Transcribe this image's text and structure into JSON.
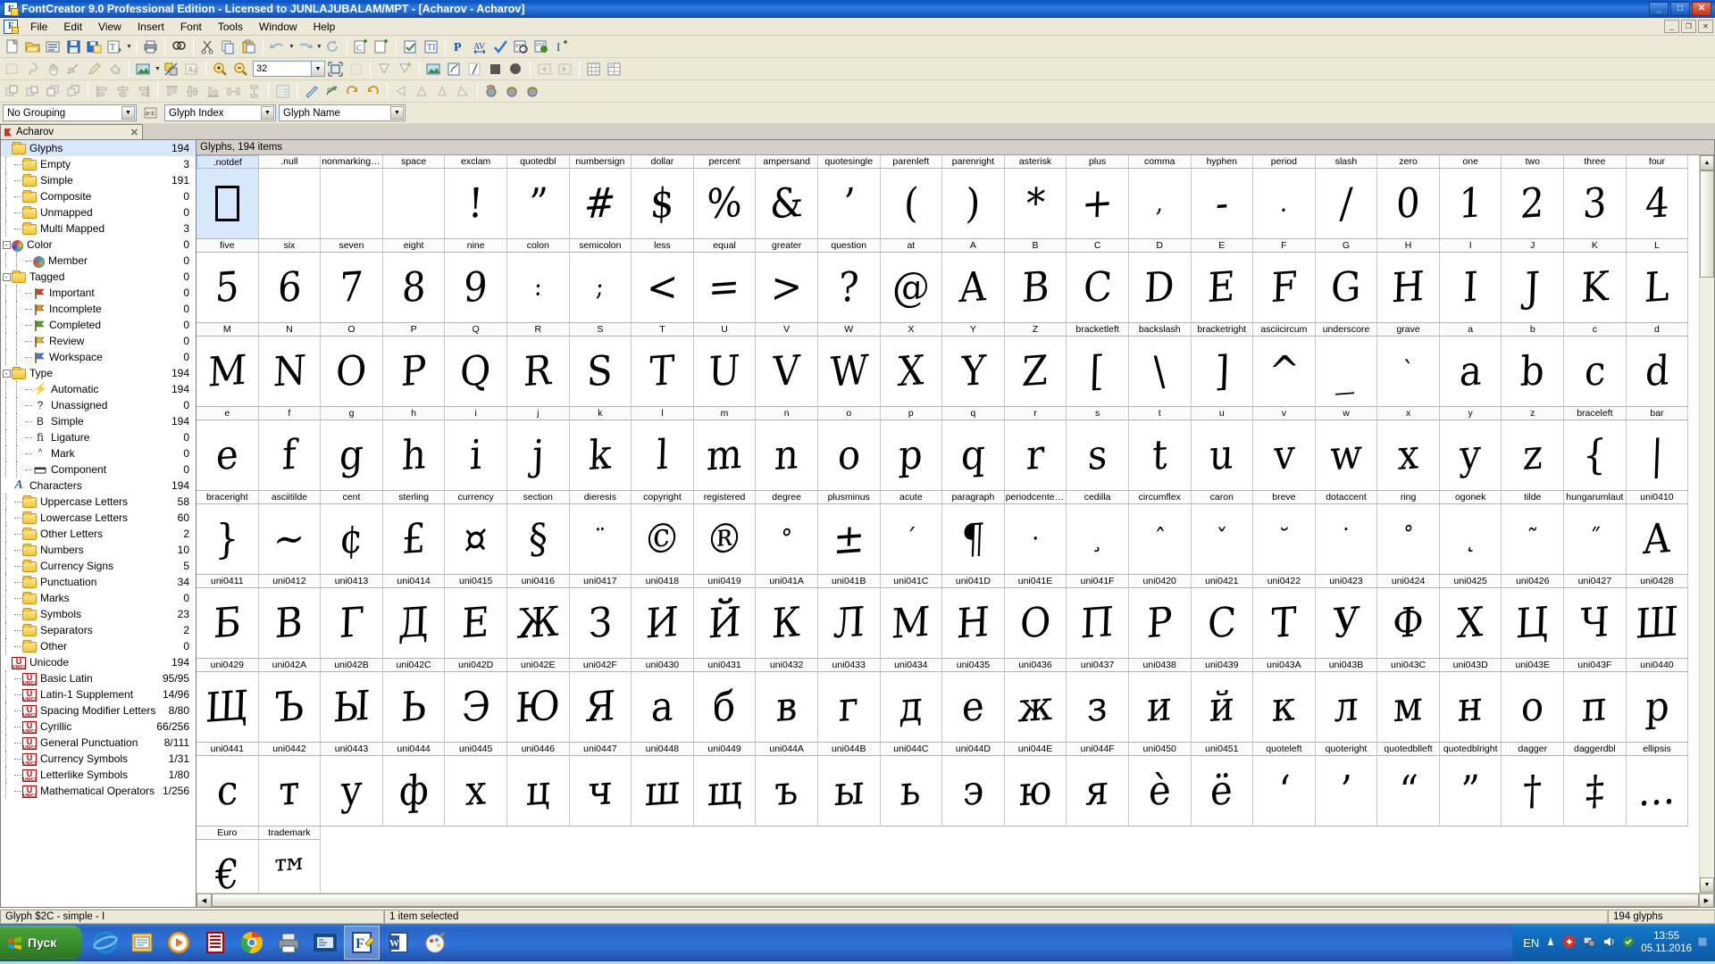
{
  "window": {
    "title": "FontCreator 9.0 Professional Edition - Licensed to JUNLAJUBALAM/MPT - [Acharov - Acharov]",
    "app_icon": "F",
    "minimize": "_",
    "maximize": "□",
    "close": "✕",
    "mdi_minimize": "_",
    "mdi_restore": "❐",
    "mdi_close": "✕"
  },
  "menu": {
    "items": [
      "File",
      "Edit",
      "View",
      "Insert",
      "Font",
      "Tools",
      "Window",
      "Help"
    ]
  },
  "toolbars": {
    "zoom_value": "32",
    "grouping": {
      "group_by": "No Grouping",
      "sort_by": "Glyph Index",
      "display": "Glyph Name"
    }
  },
  "doctab": {
    "label": "Acharov",
    "close": "✕"
  },
  "tree": {
    "items": [
      {
        "label": "Glyphs",
        "count": "194",
        "depth": 0,
        "icon": "folder",
        "selected": true,
        "expander": ""
      },
      {
        "label": "Empty",
        "count": "3",
        "depth": 1,
        "icon": "folder",
        "expander": ""
      },
      {
        "label": "Simple",
        "count": "191",
        "depth": 1,
        "icon": "folder",
        "expander": ""
      },
      {
        "label": "Composite",
        "count": "0",
        "depth": 1,
        "icon": "folder",
        "expander": ""
      },
      {
        "label": "Unmapped",
        "count": "0",
        "depth": 1,
        "icon": "folder",
        "expander": ""
      },
      {
        "label": "Multi Mapped",
        "count": "3",
        "depth": 1,
        "icon": "folder",
        "expander": ""
      },
      {
        "label": "Color",
        "count": "0",
        "depth": 0,
        "icon": "color",
        "expander": "-"
      },
      {
        "label": "Member",
        "count": "0",
        "depth": 2,
        "icon": "member",
        "expander": ""
      },
      {
        "label": "Tagged",
        "count": "0",
        "depth": 0,
        "icon": "folder",
        "expander": "-"
      },
      {
        "label": "Important",
        "count": "0",
        "depth": 2,
        "icon": "flag-red",
        "expander": ""
      },
      {
        "label": "Incomplete",
        "count": "0",
        "depth": 2,
        "icon": "flag-orange",
        "expander": ""
      },
      {
        "label": "Completed",
        "count": "0",
        "depth": 2,
        "icon": "flag-green",
        "expander": ""
      },
      {
        "label": "Review",
        "count": "0",
        "depth": 2,
        "icon": "flag-yellow",
        "expander": ""
      },
      {
        "label": "Workspace",
        "count": "0",
        "depth": 2,
        "icon": "flag-blue",
        "expander": ""
      },
      {
        "label": "Type",
        "count": "194",
        "depth": 0,
        "icon": "folder",
        "expander": "-"
      },
      {
        "label": "Automatic",
        "count": "194",
        "depth": 2,
        "icon": "bolt",
        "expander": ""
      },
      {
        "label": "Unassigned",
        "count": "0",
        "depth": 2,
        "icon": "question",
        "expander": ""
      },
      {
        "label": "Simple",
        "count": "194",
        "depth": 2,
        "icon": "letter-B",
        "expander": ""
      },
      {
        "label": "Ligature",
        "count": "0",
        "depth": 2,
        "icon": "ligature-fi",
        "expander": ""
      },
      {
        "label": "Mark",
        "count": "0",
        "depth": 2,
        "icon": "caret-mark",
        "expander": ""
      },
      {
        "label": "Component",
        "count": "0",
        "depth": 2,
        "icon": "component",
        "expander": ""
      },
      {
        "label": "Characters",
        "count": "194",
        "depth": 0,
        "icon": "letter-A",
        "expander": ""
      },
      {
        "label": "Uppercase Letters",
        "count": "58",
        "depth": 1,
        "icon": "folder",
        "expander": ""
      },
      {
        "label": "Lowercase Letters",
        "count": "60",
        "depth": 1,
        "icon": "folder",
        "expander": ""
      },
      {
        "label": "Other Letters",
        "count": "2",
        "depth": 1,
        "icon": "folder",
        "expander": ""
      },
      {
        "label": "Numbers",
        "count": "10",
        "depth": 1,
        "icon": "folder",
        "expander": ""
      },
      {
        "label": "Currency Signs",
        "count": "5",
        "depth": 1,
        "icon": "folder",
        "expander": ""
      },
      {
        "label": "Punctuation",
        "count": "34",
        "depth": 1,
        "icon": "folder",
        "expander": ""
      },
      {
        "label": "Marks",
        "count": "0",
        "depth": 1,
        "icon": "folder",
        "expander": ""
      },
      {
        "label": "Symbols",
        "count": "23",
        "depth": 1,
        "icon": "folder",
        "expander": ""
      },
      {
        "label": "Separators",
        "count": "2",
        "depth": 1,
        "icon": "folder",
        "expander": ""
      },
      {
        "label": "Other",
        "count": "0",
        "depth": 1,
        "icon": "folder",
        "expander": ""
      },
      {
        "label": "Unicode",
        "count": "194",
        "depth": 0,
        "icon": "unicode",
        "expander": ""
      },
      {
        "label": "Basic Latin",
        "count": "95/95",
        "depth": 1,
        "icon": "unicode",
        "expander": ""
      },
      {
        "label": "Latin-1 Supplement",
        "count": "14/96",
        "depth": 1,
        "icon": "unicode",
        "expander": ""
      },
      {
        "label": "Spacing Modifier Letters",
        "count": "8/80",
        "depth": 1,
        "icon": "unicode",
        "expander": ""
      },
      {
        "label": "Cyrillic",
        "count": "66/256",
        "depth": 1,
        "icon": "unicode",
        "expander": ""
      },
      {
        "label": "General Punctuation",
        "count": "8/111",
        "depth": 1,
        "icon": "unicode",
        "expander": ""
      },
      {
        "label": "Currency Symbols",
        "count": "1/31",
        "depth": 1,
        "icon": "unicode",
        "expander": ""
      },
      {
        "label": "Letterlike Symbols",
        "count": "1/80",
        "depth": 1,
        "icon": "unicode",
        "expander": ""
      },
      {
        "label": "Mathematical Operators",
        "count": "1/256",
        "depth": 1,
        "icon": "unicode",
        "expander": ""
      }
    ]
  },
  "glyphgrid": {
    "header": "Glyphs, 194 items",
    "columns": 22,
    "rows": [
      {
        "labels": [
          ".notdef",
          ".null",
          "nonmarkingre...",
          "space",
          "exclam",
          "quotedbl",
          "numbersign",
          "dollar",
          "percent",
          "ampersand",
          "quotesingle",
          "parenleft",
          "parenright",
          "asterisk",
          "plus",
          "comma",
          "hyphen",
          "period",
          "slash",
          "zero",
          "one",
          "two",
          "three",
          "four"
        ],
        "glyphs": [
          "□",
          "",
          "",
          "",
          "!",
          "”",
          "#",
          "$",
          "%",
          "&",
          "’",
          "(",
          ")",
          "*",
          "+",
          ",",
          "-",
          ".",
          "/",
          "0",
          "1",
          "2",
          "3",
          "4"
        ]
      },
      {
        "labels": [
          "five",
          "six",
          "seven",
          "eight",
          "nine",
          "colon",
          "semicolon",
          "less",
          "equal",
          "greater",
          "question",
          "at",
          "A",
          "B",
          "C",
          "D",
          "E",
          "F",
          "G",
          "H",
          "I",
          "J",
          "K",
          "L"
        ],
        "glyphs": [
          "5",
          "6",
          "7",
          "8",
          "9",
          ":",
          ";",
          "<",
          "=",
          ">",
          "?",
          "@",
          "A",
          "B",
          "C",
          "D",
          "E",
          "F",
          "G",
          "H",
          "I",
          "J",
          "K",
          "L"
        ]
      },
      {
        "labels": [
          "M",
          "N",
          "O",
          "P",
          "Q",
          "R",
          "S",
          "T",
          "U",
          "V",
          "W",
          "X",
          "Y",
          "Z",
          "bracketleft",
          "backslash",
          "bracketright",
          "asciicircum",
          "underscore",
          "grave",
          "a",
          "b",
          "c",
          "d"
        ],
        "glyphs": [
          "M",
          "N",
          "O",
          "P",
          "Q",
          "R",
          "S",
          "T",
          "U",
          "V",
          "W",
          "X",
          "Y",
          "Z",
          "[",
          "\\",
          "]",
          "^",
          "_",
          "`",
          "a",
          "b",
          "c",
          "d"
        ]
      },
      {
        "labels": [
          "e",
          "f",
          "g",
          "h",
          "i",
          "j",
          "k",
          "l",
          "m",
          "n",
          "o",
          "p",
          "q",
          "r",
          "s",
          "t",
          "u",
          "v",
          "w",
          "x",
          "y",
          "z",
          "braceleft",
          "bar"
        ],
        "glyphs": [
          "e",
          "f",
          "g",
          "h",
          "i",
          "j",
          "k",
          "l",
          "m",
          "n",
          "o",
          "p",
          "q",
          "r",
          "s",
          "t",
          "u",
          "v",
          "w",
          "x",
          "y",
          "z",
          "{",
          "|"
        ]
      },
      {
        "labels": [
          "braceright",
          "asciitilde",
          "cent",
          "sterling",
          "currency",
          "section",
          "dieresis",
          "copyright",
          "registered",
          "degree",
          "plusminus",
          "acute",
          "paragraph",
          "periodcentered",
          "cedilla",
          "circumflex",
          "caron",
          "breve",
          "dotaccent",
          "ring",
          "ogonek",
          "tilde",
          "hungarumlaut",
          "uni0410"
        ],
        "glyphs": [
          "}",
          "~",
          "¢",
          "£",
          "¤",
          "§",
          "¨",
          "©",
          "®",
          "°",
          "±",
          "´",
          "¶",
          "·",
          "¸",
          "ˆ",
          "ˇ",
          "˘",
          "˙",
          "˚",
          "˛",
          "˜",
          "˝",
          "А"
        ]
      },
      {
        "labels": [
          "uni0411",
          "uni0412",
          "uni0413",
          "uni0414",
          "uni0415",
          "uni0416",
          "uni0417",
          "uni0418",
          "uni0419",
          "uni041A",
          "uni041B",
          "uni041C",
          "uni041D",
          "uni041E",
          "uni041F",
          "uni0420",
          "uni0421",
          "uni0422",
          "uni0423",
          "uni0424",
          "uni0425",
          "uni0426",
          "uni0427",
          "uni0428"
        ],
        "glyphs": [
          "Б",
          "В",
          "Г",
          "Д",
          "Е",
          "Ж",
          "З",
          "И",
          "Й",
          "К",
          "Л",
          "М",
          "Н",
          "О",
          "П",
          "Р",
          "С",
          "Т",
          "У",
          "Ф",
          "Х",
          "Ц",
          "Ч",
          "Ш"
        ]
      },
      {
        "labels": [
          "uni0429",
          "uni042A",
          "uni042B",
          "uni042C",
          "uni042D",
          "uni042E",
          "uni042F",
          "uni0430",
          "uni0431",
          "uni0432",
          "uni0433",
          "uni0434",
          "uni0435",
          "uni0436",
          "uni0437",
          "uni0438",
          "uni0439",
          "uni043A",
          "uni043B",
          "uni043C",
          "uni043D",
          "uni043E",
          "uni043F",
          "uni0440"
        ],
        "glyphs": [
          "Щ",
          "Ъ",
          "Ы",
          "Ь",
          "Э",
          "Ю",
          "Я",
          "а",
          "б",
          "в",
          "г",
          "д",
          "е",
          "ж",
          "з",
          "и",
          "й",
          "к",
          "л",
          "м",
          "н",
          "о",
          "п",
          "р"
        ]
      },
      {
        "labels": [
          "uni0441",
          "uni0442",
          "uni0443",
          "uni0444",
          "uni0445",
          "uni0446",
          "uni0447",
          "uni0448",
          "uni0449",
          "uni044A",
          "uni044B",
          "uni044C",
          "uni044D",
          "uni044E",
          "uni044F",
          "uni0450",
          "uni0451",
          "quoteleft",
          "quoteright",
          "quotedblleft",
          "quotedblright",
          "dagger",
          "daggerdbl",
          "ellipsis"
        ],
        "glyphs": [
          "с",
          "т",
          "у",
          "ф",
          "х",
          "ц",
          "ч",
          "ш",
          "щ",
          "ъ",
          "ы",
          "ь",
          "э",
          "ю",
          "я",
          "ѐ",
          "ё",
          "‘",
          "’",
          "“",
          "”",
          "†",
          "‡",
          "…"
        ]
      },
      {
        "labels": [
          "Euro",
          "trademark"
        ],
        "glyphs": [
          "€",
          "™"
        ]
      }
    ]
  },
  "statusbar": {
    "left": "Glyph $2C - simple - I",
    "center": "1 item selected",
    "right": "194 glyphs"
  },
  "taskbar": {
    "start": "Пуск",
    "buttons": [
      "internet-explorer",
      "file-manager",
      "media-player",
      "database",
      "chrome",
      "printer",
      "terminal",
      "fontcreator",
      "word",
      "paint"
    ],
    "lang": "EN",
    "time": "13:55",
    "date": "05.11.2016"
  }
}
